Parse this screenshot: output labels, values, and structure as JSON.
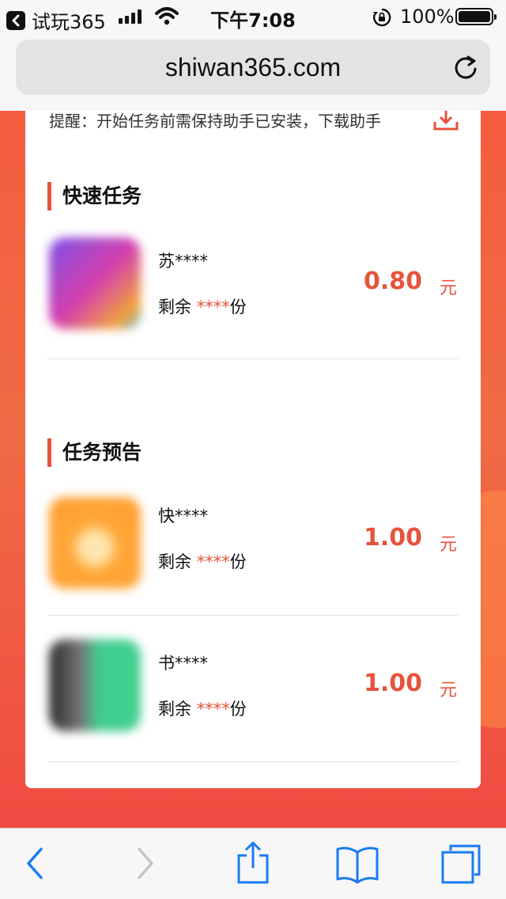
{
  "status_bar": {
    "back_app_label": "试玩365",
    "time": "下午7:08",
    "battery": "100%"
  },
  "browser": {
    "url": "shiwan365.com"
  },
  "page": {
    "reminder": "提醒：开始任务前需保持助手已安装，下载助手",
    "sections": [
      {
        "title": "快速任务",
        "tasks": [
          {
            "name": "苏****",
            "remain_prefix": "剩余 ",
            "remain_stars": "****",
            "remain_suffix": "份",
            "price": "0.80",
            "unit": "元"
          }
        ]
      },
      {
        "title": "任务预告",
        "tasks": [
          {
            "name": "快****",
            "remain_prefix": "剩余 ",
            "remain_stars": "****",
            "remain_suffix": "份",
            "price": "1.00",
            "unit": "元"
          },
          {
            "name": "书****",
            "remain_prefix": "剩余 ",
            "remain_stars": "****",
            "remain_suffix": "份",
            "price": "1.00",
            "unit": "元"
          }
        ]
      }
    ]
  },
  "icons": {
    "back_app": "chevron-left-icon",
    "signal": "cellular-signal-icon",
    "wifi": "wifi-icon",
    "lock": "rotation-lock-icon",
    "battery": "battery-icon",
    "reload": "reload-icon",
    "download": "download-icon",
    "toolbar": [
      "back-icon",
      "forward-icon",
      "share-icon",
      "bookmarks-icon",
      "tabs-icon"
    ]
  },
  "colors": {
    "accent": "#e6533b",
    "page_background": "#f45d3f",
    "toolbar_icon": "#1a7cf0"
  }
}
